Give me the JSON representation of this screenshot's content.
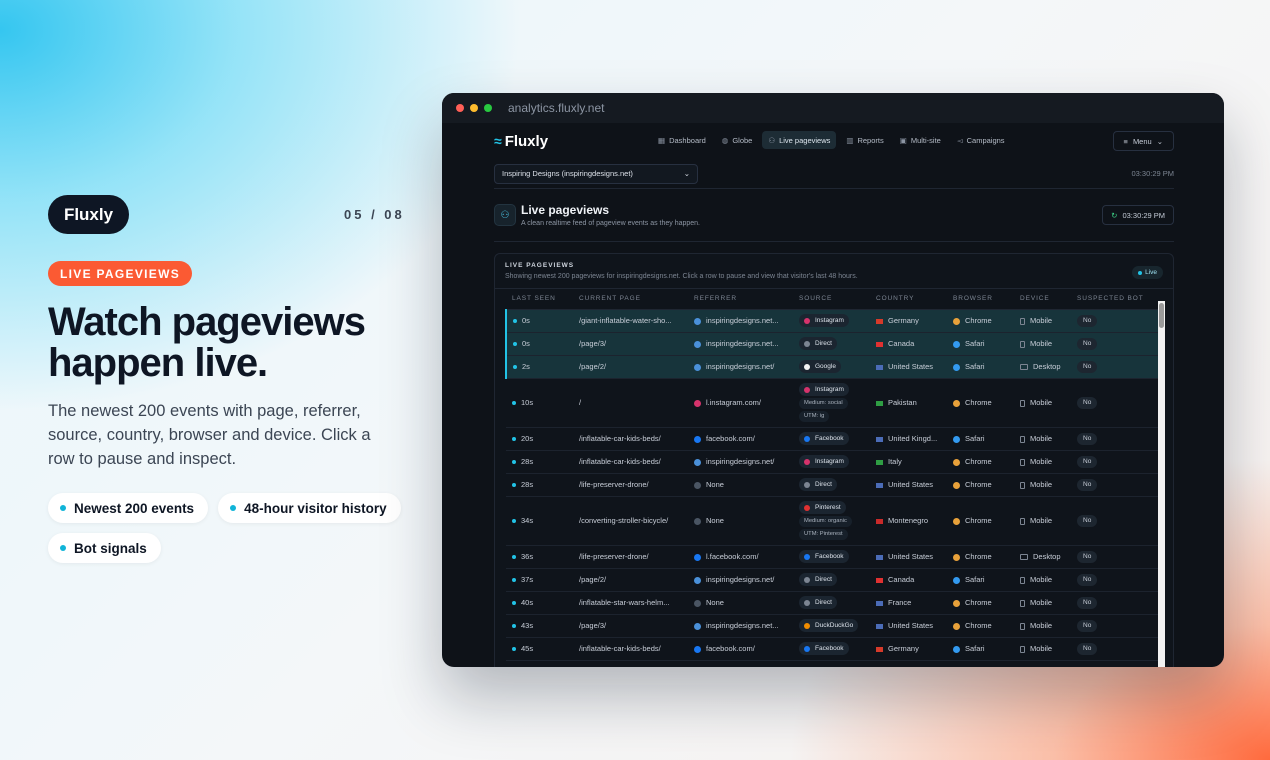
{
  "hero": {
    "brand": "Fluxly",
    "counter": "05 / 08",
    "tag": "LIVE PAGEVIEWS",
    "headline": "Watch pageviews happen live.",
    "subcopy": "The newest 200 events with page, referrer, source, country, browser and device. Click a row to pause and inspect.",
    "chips": [
      "Newest 200 events",
      "48-hour visitor history",
      "Bot signals"
    ]
  },
  "window": {
    "url": "analytics.fluxly.net"
  },
  "app": {
    "logo": "Fluxly",
    "tabs": [
      {
        "label": "Dashboard",
        "icon": "grid-icon"
      },
      {
        "label": "Globe",
        "icon": "globe-icon"
      },
      {
        "label": "Live pageviews",
        "icon": "users-icon"
      },
      {
        "label": "Reports",
        "icon": "bar-chart-icon"
      },
      {
        "label": "Multi-site",
        "icon": "layers-icon"
      },
      {
        "label": "Campaigns",
        "icon": "megaphone-icon"
      }
    ],
    "menu_label": "Menu",
    "site_select": "Inspiring Designs (inspiringdesigns.net)",
    "clock": "03:30:29 PM",
    "page_title": "Live pageviews",
    "page_subtitle": "A clean realtime feed of pageview events as they happen.",
    "refresh_time": "03:30:29 PM",
    "panel_label": "LIVE PAGEVIEWS",
    "panel_desc": "Showing newest 200 pageviews for inspiringdesigns.net. Click a row to pause and view that visitor's last 48 hours.",
    "live_badge": "Live",
    "columns": [
      "LAST SEEN",
      "CURRENT PAGE",
      "REFERRER",
      "SOURCE",
      "COUNTRY",
      "BROWSER",
      "DEVICE",
      "SUSPECTED BOT"
    ],
    "colors": {
      "accent": "#22c3e6",
      "tag": "#fb5a33",
      "dark": "#0e1624"
    },
    "rows": [
      {
        "seen": "0s",
        "page": "/giant-inflatable-water-sho...",
        "ref": "inspiringdesigns.net...",
        "ref_color": "#4a90d9",
        "source": "Instagram",
        "src_color": "#d6336c",
        "country": "Germany",
        "flag": "#d63a2a",
        "browser": "Chrome",
        "br_color": "#e8a13a",
        "device": "Mobile",
        "bot": "No",
        "sel": true,
        "meta": []
      },
      {
        "seen": "0s",
        "page": "/page/3/",
        "ref": "inspiringdesigns.net...",
        "ref_color": "#4a90d9",
        "source": "Direct",
        "src_color": "#7c8592",
        "country": "Canada",
        "flag": "#e03131",
        "browser": "Safari",
        "br_color": "#339af0",
        "device": "Mobile",
        "bot": "No",
        "sel": true,
        "meta": []
      },
      {
        "seen": "2s",
        "page": "/page/2/",
        "ref": "inspiringdesigns.net/",
        "ref_color": "#4a90d9",
        "source": "Google",
        "src_color": "#f2f2f2",
        "country": "United States",
        "flag": "#4b6cb7",
        "browser": "Safari",
        "br_color": "#339af0",
        "device": "Desktop",
        "bot": "No",
        "sel": true,
        "meta": []
      },
      {
        "seen": "10s",
        "page": "/",
        "ref": "l.instagram.com/",
        "ref_color": "#d6336c",
        "source": "Instagram",
        "src_color": "#d6336c",
        "country": "Pakistan",
        "flag": "#2f9e44",
        "browser": "Chrome",
        "br_color": "#e8a13a",
        "device": "Mobile",
        "bot": "No",
        "sel": false,
        "meta": [
          "Medium: social",
          "UTM: ig"
        ]
      },
      {
        "seen": "20s",
        "page": "/inflatable-car-kids-beds/",
        "ref": "facebook.com/",
        "ref_color": "#1877f2",
        "source": "Facebook",
        "src_color": "#1877f2",
        "country": "United Kingd...",
        "flag": "#4b6cb7",
        "browser": "Safari",
        "br_color": "#339af0",
        "device": "Mobile",
        "bot": "No",
        "sel": false,
        "meta": []
      },
      {
        "seen": "28s",
        "page": "/inflatable-car-kids-beds/",
        "ref": "inspiringdesigns.net/",
        "ref_color": "#4a90d9",
        "source": "Instagram",
        "src_color": "#d6336c",
        "country": "Italy",
        "flag": "#2f9e44",
        "browser": "Chrome",
        "br_color": "#e8a13a",
        "device": "Mobile",
        "bot": "No",
        "sel": false,
        "meta": []
      },
      {
        "seen": "28s",
        "page": "/life-preserver-drone/",
        "ref": "None",
        "ref_color": "#4a5563",
        "source": "Direct",
        "src_color": "#7c8592",
        "country": "United States",
        "flag": "#4b6cb7",
        "browser": "Chrome",
        "br_color": "#e8a13a",
        "device": "Mobile",
        "bot": "No",
        "sel": false,
        "meta": []
      },
      {
        "seen": "34s",
        "page": "/converting-stroller-bicycle/",
        "ref": "None",
        "ref_color": "#4a5563",
        "source": "Pinterest",
        "src_color": "#e03131",
        "country": "Montenegro",
        "flag": "#c92a2a",
        "browser": "Chrome",
        "br_color": "#e8a13a",
        "device": "Mobile",
        "bot": "No",
        "sel": false,
        "meta": [
          "Medium: organic",
          "UTM: Pinterest"
        ]
      },
      {
        "seen": "36s",
        "page": "/life-preserver-drone/",
        "ref": "l.facebook.com/",
        "ref_color": "#1877f2",
        "source": "Facebook",
        "src_color": "#1877f2",
        "country": "United States",
        "flag": "#4b6cb7",
        "browser": "Chrome",
        "br_color": "#e8a13a",
        "device": "Desktop",
        "bot": "No",
        "sel": false,
        "meta": []
      },
      {
        "seen": "37s",
        "page": "/page/2/",
        "ref": "inspiringdesigns.net/",
        "ref_color": "#4a90d9",
        "source": "Direct",
        "src_color": "#7c8592",
        "country": "Canada",
        "flag": "#e03131",
        "browser": "Safari",
        "br_color": "#339af0",
        "device": "Mobile",
        "bot": "No",
        "sel": false,
        "meta": []
      },
      {
        "seen": "40s",
        "page": "/inflatable-star-wars-helm...",
        "ref": "None",
        "ref_color": "#4a5563",
        "source": "Direct",
        "src_color": "#7c8592",
        "country": "France",
        "flag": "#4b6cb7",
        "browser": "Chrome",
        "br_color": "#e8a13a",
        "device": "Mobile",
        "bot": "No",
        "sel": false,
        "meta": []
      },
      {
        "seen": "43s",
        "page": "/page/3/",
        "ref": "inspiringdesigns.net...",
        "ref_color": "#4a90d9",
        "source": "DuckDuckGo",
        "src_color": "#f08c00",
        "country": "United States",
        "flag": "#4b6cb7",
        "browser": "Chrome",
        "br_color": "#e8a13a",
        "device": "Mobile",
        "bot": "No",
        "sel": false,
        "meta": []
      },
      {
        "seen": "45s",
        "page": "/inflatable-car-kids-beds/",
        "ref": "facebook.com/",
        "ref_color": "#1877f2",
        "source": "Facebook",
        "src_color": "#1877f2",
        "country": "Germany",
        "flag": "#d63a2a",
        "browser": "Safari",
        "br_color": "#339af0",
        "device": "Mobile",
        "bot": "No",
        "sel": false,
        "meta": []
      }
    ]
  }
}
